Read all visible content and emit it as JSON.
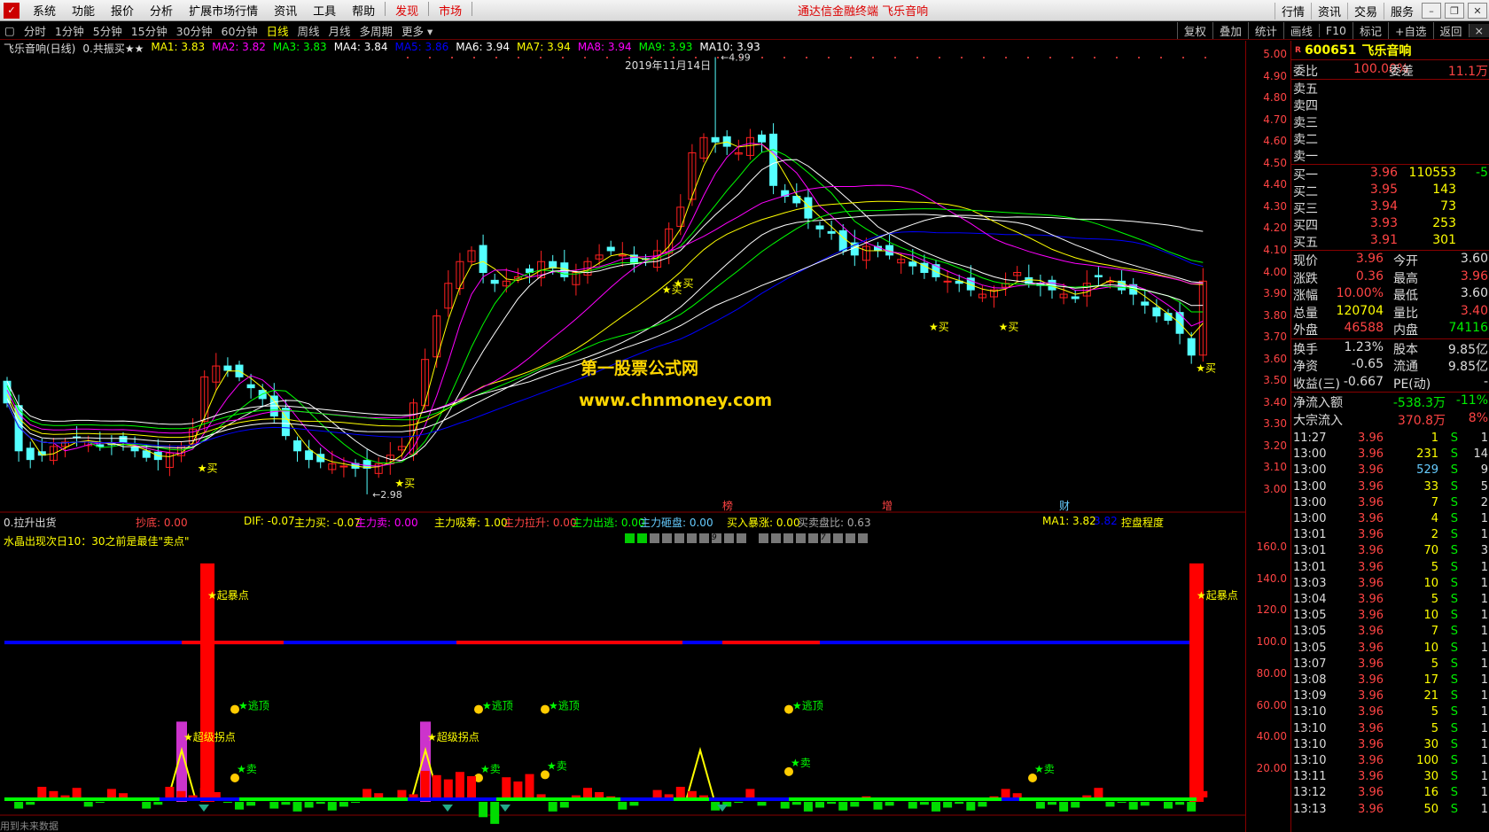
{
  "menu": {
    "items": [
      "系统",
      "功能",
      "报价",
      "分析",
      "扩展市场行情",
      "资讯",
      "工具",
      "帮助"
    ],
    "red_items": [
      "发现",
      "市场"
    ],
    "title": "通达信金融终端  飞乐音响",
    "right": [
      "行情",
      "资讯",
      "交易",
      "服务"
    ]
  },
  "tabs": {
    "items": [
      "分时",
      "1分钟",
      "5分钟",
      "15分钟",
      "30分钟",
      "60分钟",
      "日线",
      "周线",
      "月线",
      "多周期",
      "更多"
    ],
    "active": "日线",
    "tools": [
      "复权",
      "叠加",
      "统计",
      "画线",
      "F10",
      "标记",
      "+自选",
      "返回"
    ]
  },
  "chart_header": {
    "title": "飞乐音响(日线)",
    "formula": "0.共振买★★",
    "ma": [
      {
        "label": "MA1: 3.83",
        "color": "#ffff00"
      },
      {
        "label": "MA2: 3.82",
        "color": "#ff00ff"
      },
      {
        "label": "MA3: 3.83",
        "color": "#00ff00"
      },
      {
        "label": "MA4: 3.84",
        "color": "#ffffff"
      },
      {
        "label": "MA5: 3.86",
        "color": "#0000ff"
      },
      {
        "label": "MA6: 3.94",
        "color": "#ffffff"
      },
      {
        "label": "MA7: 3.94",
        "color": "#ffff00"
      },
      {
        "label": "MA8: 3.94",
        "color": "#ff00ff"
      },
      {
        "label": "MA9: 3.93",
        "color": "#00ff00"
      },
      {
        "label": "MA10: 3.93",
        "color": "#ffffff"
      }
    ],
    "date": "2019年11月14日",
    "high_label": "4.99",
    "low_label": "2.98"
  },
  "watermark": {
    "line1": "第一股票公式网",
    "line2": "www.chnmoney.com"
  },
  "signals": {
    "buy": "★买",
    "sell": "★卖",
    "top": "逃顶",
    "spike": "★起暴点",
    "turn": "★超级拐点"
  },
  "badges": [
    "榜",
    "增",
    "财"
  ],
  "indicator": {
    "name": "0.拉升出货",
    "items": [
      {
        "t": "抄底: 0.00",
        "c": "#ff4444"
      },
      {
        "t": "DIF: -0.07",
        "c": "#ffff00"
      },
      {
        "t": "主力买: -0.07",
        "c": "#ffff00"
      },
      {
        "t": "主力卖: 0.00",
        "c": "#ff00ff"
      },
      {
        "t": "主力吸筹: 1.00",
        "c": "#ffff00"
      },
      {
        "t": "主力拉升: 0.00",
        "c": "#ff4444"
      },
      {
        "t": "主力出逃: 0.00",
        "c": "#00ff00"
      },
      {
        "t": "主力砸盘: 0.00",
        "c": "#66ccff"
      },
      {
        "t": "买入暴涨: 0.00",
        "c": "#ffff00"
      },
      {
        "t": "买卖盘比: 0.63",
        "c": "#aaaaaa"
      },
      {
        "t": "MA1: 3.82",
        "c": "#ffff00"
      },
      {
        "t": "3.82",
        "c": "#0000ff"
      },
      {
        "t": "控盘程度",
        "c": "#ffff00"
      }
    ],
    "note": "水晶出现次日10：30之前是最佳\"卖点\"",
    "dot_nums": [
      "9",
      "7"
    ]
  },
  "price_axis": [
    "5.00",
    "4.90",
    "4.80",
    "4.70",
    "4.60",
    "4.50",
    "4.40",
    "4.30",
    "4.20",
    "4.10",
    "4.00",
    "3.90",
    "3.80",
    "3.70",
    "3.60",
    "3.50",
    "3.40",
    "3.30",
    "3.20",
    "3.10",
    "3.00"
  ],
  "ind_axis": [
    "160.0",
    "140.0",
    "120.0",
    "100.0",
    "80.00",
    "60.00",
    "40.00",
    "20.00"
  ],
  "footer": "用到未来数据",
  "quote": {
    "code": "600651",
    "name": "飞乐音响",
    "r_mark": "R",
    "webi": {
      "label": "委比",
      "value": "100.00%",
      "label2": "委差",
      "value2": "11.1万"
    },
    "sell": [
      "卖五",
      "卖四",
      "卖三",
      "卖二",
      "卖一"
    ],
    "buy": [
      {
        "l": "买一",
        "p": "3.96",
        "v": "110553",
        "d": "-5"
      },
      {
        "l": "买二",
        "p": "3.95",
        "v": "143",
        "d": ""
      },
      {
        "l": "买三",
        "p": "3.94",
        "v": "73",
        "d": ""
      },
      {
        "l": "买四",
        "p": "3.93",
        "v": "253",
        "d": ""
      },
      {
        "l": "买五",
        "p": "3.91",
        "v": "301",
        "d": ""
      }
    ],
    "stats": [
      {
        "a": "现价",
        "b": "3.96",
        "c": "今开",
        "d": "3.60",
        "bc": "r",
        "dc": "w"
      },
      {
        "a": "涨跌",
        "b": "0.36",
        "c": "最高",
        "d": "3.96",
        "bc": "r",
        "dc": "r"
      },
      {
        "a": "涨幅",
        "b": "10.00%",
        "c": "最低",
        "d": "3.60",
        "bc": "r",
        "dc": "w"
      },
      {
        "a": "总量",
        "b": "120704",
        "c": "量比",
        "d": "3.40",
        "bc": "y",
        "dc": "r"
      },
      {
        "a": "外盘",
        "b": "46588",
        "c": "内盘",
        "d": "74116",
        "bc": "r",
        "dc": "g"
      }
    ],
    "stats2": [
      {
        "a": "换手",
        "b": "1.23%",
        "c": "股本",
        "d": "9.85亿"
      },
      {
        "a": "净资",
        "b": "-0.65",
        "c": "流通",
        "d": "9.85亿"
      },
      {
        "a": "收益(三)",
        "b": "-0.667",
        "c": "PE(动)",
        "d": "-"
      }
    ],
    "flow": [
      {
        "a": "净流入额",
        "b": "-538.3万",
        "c": "-11%",
        "bc": "g",
        "cc": "g"
      },
      {
        "a": "大宗流入",
        "b": "370.8万",
        "c": "8%",
        "bc": "r",
        "cc": "r"
      }
    ],
    "ticks": [
      [
        "11:27",
        "3.96",
        "1",
        "S",
        "1"
      ],
      [
        "13:00",
        "3.96",
        "231",
        "S",
        "14"
      ],
      [
        "13:00",
        "3.96",
        "529",
        "S",
        "9"
      ],
      [
        "13:00",
        "3.96",
        "33",
        "S",
        "5"
      ],
      [
        "13:00",
        "3.96",
        "7",
        "S",
        "2"
      ],
      [
        "13:00",
        "3.96",
        "4",
        "S",
        "1"
      ],
      [
        "13:01",
        "3.96",
        "2",
        "S",
        "1"
      ],
      [
        "13:01",
        "3.96",
        "70",
        "S",
        "3"
      ],
      [
        "13:01",
        "3.96",
        "5",
        "S",
        "1"
      ],
      [
        "13:03",
        "3.96",
        "10",
        "S",
        "1"
      ],
      [
        "13:04",
        "3.96",
        "5",
        "S",
        "1"
      ],
      [
        "13:05",
        "3.96",
        "10",
        "S",
        "1"
      ],
      [
        "13:05",
        "3.96",
        "7",
        "S",
        "1"
      ],
      [
        "13:05",
        "3.96",
        "10",
        "S",
        "1"
      ],
      [
        "13:07",
        "3.96",
        "5",
        "S",
        "1"
      ],
      [
        "13:08",
        "3.96",
        "17",
        "S",
        "1"
      ],
      [
        "13:09",
        "3.96",
        "21",
        "S",
        "1"
      ],
      [
        "13:10",
        "3.96",
        "5",
        "S",
        "1"
      ],
      [
        "13:10",
        "3.96",
        "5",
        "S",
        "1"
      ],
      [
        "13:10",
        "3.96",
        "30",
        "S",
        "1"
      ],
      [
        "13:10",
        "3.96",
        "100",
        "S",
        "1"
      ],
      [
        "13:11",
        "3.96",
        "30",
        "S",
        "1"
      ],
      [
        "13:12",
        "3.96",
        "16",
        "S",
        "1"
      ],
      [
        "13:13",
        "3.96",
        "50",
        "S",
        "1"
      ]
    ]
  },
  "colors": {
    "up": "#ff2020",
    "down": "#54ffff",
    "bg": "#000000",
    "grid": "#880000"
  }
}
